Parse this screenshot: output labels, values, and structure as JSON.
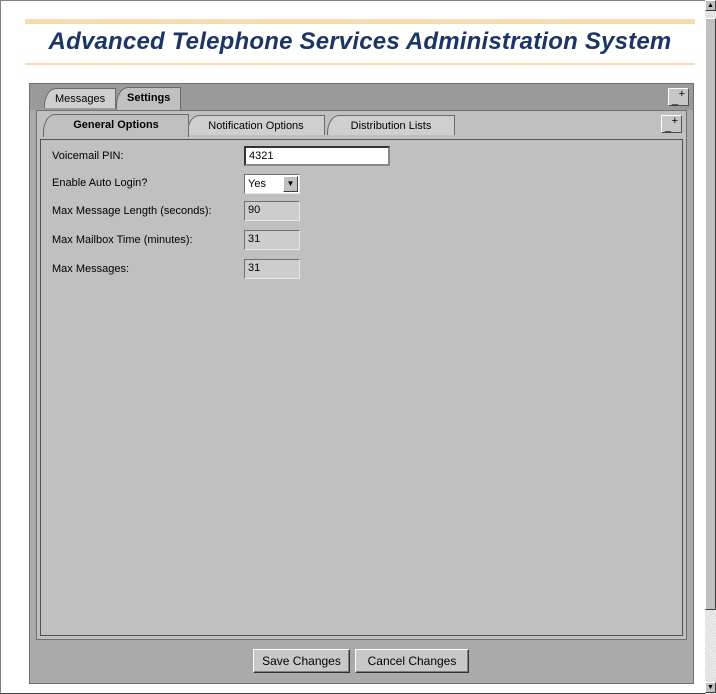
{
  "header": {
    "title": "Advanced Telephone Services Administration System"
  },
  "outer_tabs": [
    {
      "label": "Messages",
      "active": false
    },
    {
      "label": "Settings",
      "active": true
    }
  ],
  "inner_tabs": [
    {
      "label": "General Options",
      "active": true
    },
    {
      "label": "Notification Options",
      "active": false
    },
    {
      "label": "Distribution Lists",
      "active": false
    }
  ],
  "form": {
    "voicemail_pin": {
      "label": "Voicemail PIN:",
      "value": "4321"
    },
    "auto_login": {
      "label": "Enable Auto Login?",
      "value": "Yes"
    },
    "max_message_length": {
      "label": "Max Message Length (seconds):",
      "value": "90"
    },
    "max_mailbox_time": {
      "label": "Max Mailbox Time (minutes):",
      "value": "31"
    },
    "max_messages": {
      "label": "Max Messages:",
      "value": "31"
    }
  },
  "buttons": {
    "save": "Save Changes",
    "cancel": "Cancel Changes"
  },
  "icons": {
    "maximize": "maximize-icon",
    "dropdown": "chevron-down-icon"
  },
  "colors": {
    "title": "#1c3466",
    "header_rule": "#f5ddb0",
    "panel": "#c0c0c0"
  }
}
